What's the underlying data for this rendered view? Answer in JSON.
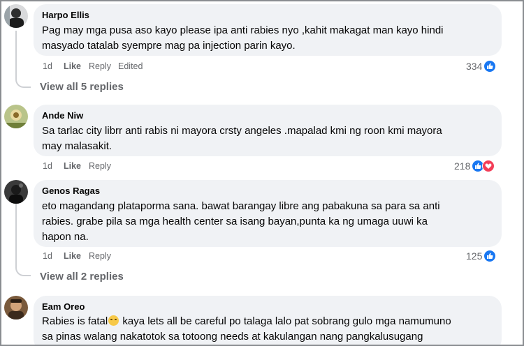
{
  "comments": [
    {
      "author": "Harpo Ellis",
      "lines": [
        "Pag may mga pusa aso kayo please ipa anti rabies nyo ,kahit makagat man kayo hindi",
        "masyado tatalab syempre mag pa injection parin kayo."
      ],
      "time": "1d",
      "like": "Like",
      "reply": "Reply",
      "edited": "Edited",
      "reaction_count": "334",
      "reactions": [
        "like-icon"
      ],
      "view_replies": "View all 5 replies"
    },
    {
      "author": "Ande Niw",
      "lines": [
        "Sa tarlac city librr anti rabis ni mayora crsty angeles .mapalad kmi ng roon kmi mayora",
        "may malasakit."
      ],
      "time": "1d",
      "like": "Like",
      "reply": "Reply",
      "reaction_count": "218",
      "reactions": [
        "like-icon",
        "love-icon"
      ]
    },
    {
      "author": "Genos Ragas",
      "lines": [
        "eto magandang plataporma sana. bawat barangay libre ang pabakuna sa para sa anti",
        "rabies. grabe pila sa mga health center sa isang bayan,punta ka ng umaga uuwi ka",
        "hapon na."
      ],
      "time": "1d",
      "like": "Like",
      "reply": "Reply",
      "reaction_count": "125",
      "reactions": [
        "like-icon"
      ],
      "view_replies": "View all 2 replies"
    },
    {
      "author": "Eam Oreo",
      "line1_before": "Rabies is fatal",
      "line1_emoji": "downcast-face-emoji",
      "line1_after": " kaya lets all be careful po talaga lalo pat sobrang gulo mga namumuno",
      "line2": "sa pinas walang nakatotok sa totoong needs at kakulangan nang pangkalusugang"
    }
  ],
  "colors": {
    "bubble": "#f0f2f5",
    "meta": "#65676b",
    "like": "#1877f2",
    "love": "#f33e58"
  }
}
